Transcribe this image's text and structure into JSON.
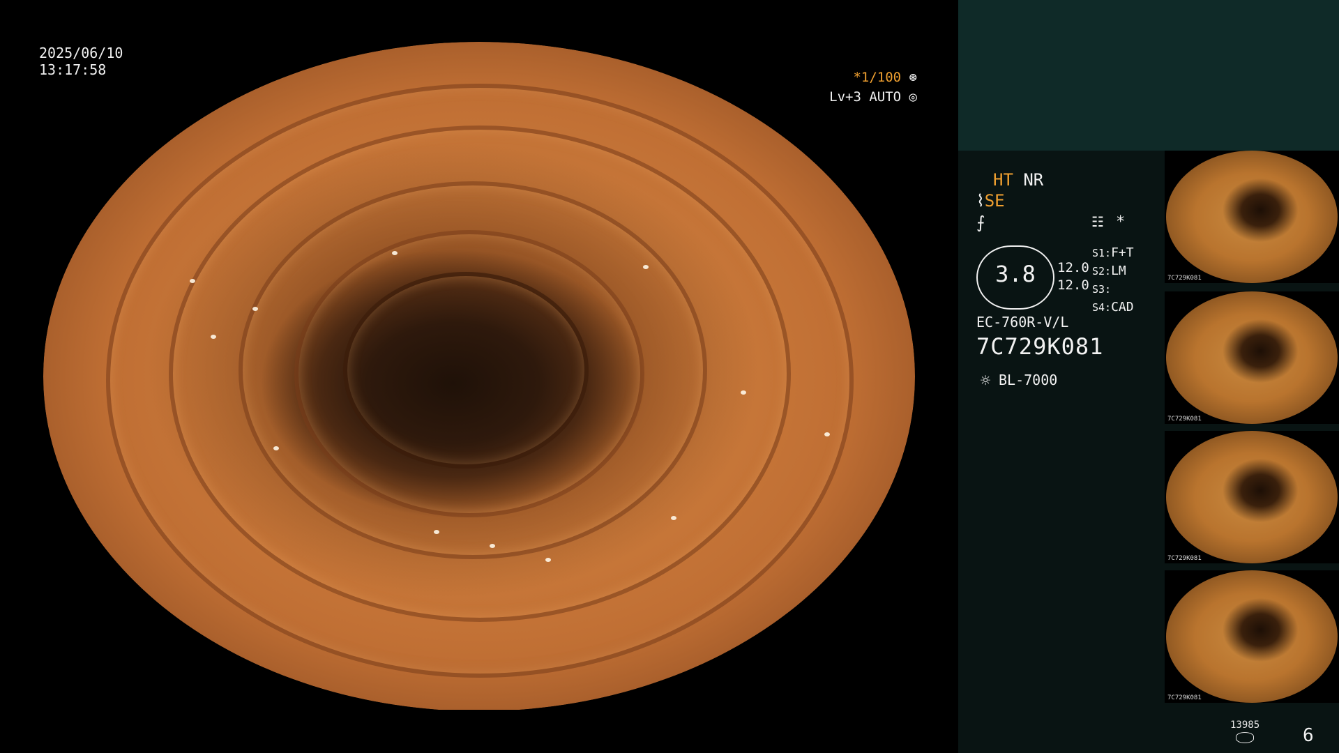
{
  "datetime": {
    "date": "2025/06/10",
    "time": "13:17:58"
  },
  "overlay": {
    "zoom": "*1/100",
    "level": "Lv+3 AUTO"
  },
  "modes": {
    "ht": "HT",
    "nr": "NR",
    "se": "SE"
  },
  "gauge": {
    "value": "3.8",
    "scale_top": "12.0",
    "scale_bottom": "12.0"
  },
  "s_settings": [
    {
      "key": "S1:",
      "value": "F+T"
    },
    {
      "key": "S2:",
      "value": "LM"
    },
    {
      "key": "S3:",
      "value": ""
    },
    {
      "key": "S4:",
      "value": "CAD"
    }
  ],
  "scope": {
    "model": "EC-760R-V/L",
    "serial": "7C729K081"
  },
  "light_source": "BL-7000",
  "thumbnail_label": "7C729K081",
  "storage": {
    "count": "13985"
  },
  "page_number": "6",
  "colors": {
    "accent": "#f0a030",
    "panel_top": "#0f2a28",
    "panel": "#091413"
  }
}
